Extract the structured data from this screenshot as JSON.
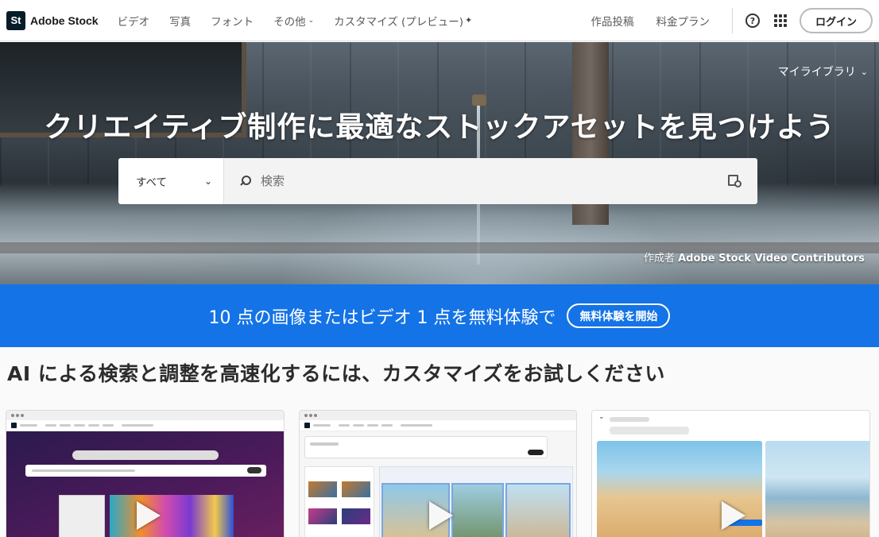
{
  "brand": {
    "logo_text": "St",
    "name": "Adobe Stock"
  },
  "nav": {
    "links": [
      "ビデオ",
      "写真",
      "フォント",
      "その他",
      "カスタマイズ (プレビュー)"
    ],
    "right_links": [
      "作品投稿",
      "料金プラン"
    ],
    "login_label": "ログイン"
  },
  "hero": {
    "title": "クリエイティブ制作に最適なストックアセットを見つけよう",
    "library_label": "マイライブラリ",
    "search": {
      "scope": "すべて",
      "placeholder": "検索"
    },
    "credit_prefix": "作成者",
    "credit_name": "Adobe Stock Video Contributors"
  },
  "promo": {
    "text": "10 点の画像またはビデオ 1 点を無料体験で",
    "button": "無料体験を開始",
    "color": "#1473e6"
  },
  "section": {
    "title": "AI による検索と調整を高速化するには、カスタマイズをお試しください"
  },
  "icons": [
    "help-icon",
    "apps-grid-icon",
    "search-icon",
    "visual-search-icon",
    "chevron-down-icon",
    "sparkle-icon",
    "play-icon"
  ]
}
